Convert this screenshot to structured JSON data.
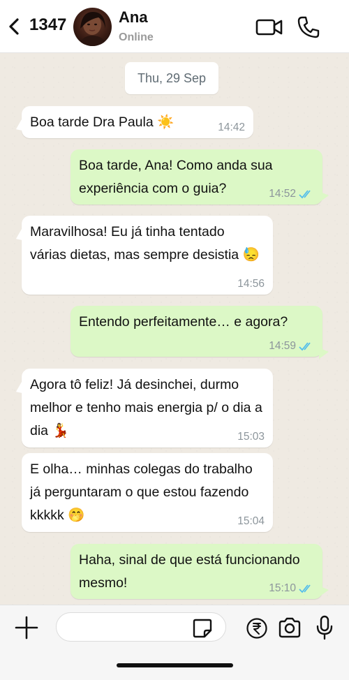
{
  "header": {
    "unread_count": "1347",
    "contact_name": "Ana",
    "contact_status": "Online",
    "icons": [
      "chevron-left-icon",
      "video-camera-icon",
      "phone-icon"
    ]
  },
  "chat": {
    "date_chip": "Thu, 29 Sep",
    "messages": [
      {
        "direction": "in",
        "text": "Boa tarde Dra Paula ☀️",
        "time": "14:42",
        "read": false
      },
      {
        "direction": "out",
        "text": "Boa tarde, Ana! Como anda sua experiência com o guia?",
        "time": "14:52",
        "read": true
      },
      {
        "direction": "in",
        "text": "Maravilhosa! Eu já tinha tentado várias dietas, mas sempre desistia 😓",
        "time": "14:56",
        "read": false
      },
      {
        "direction": "out",
        "text": "Entendo perfeitamente… e agora?",
        "time": "14:59",
        "read": true
      },
      {
        "direction": "in",
        "text": "Agora tô feliz! Já desinchei, durmo melhor e tenho mais energia p/ o dia a dia 💃",
        "time": "15:03",
        "read": false
      },
      {
        "direction": "in",
        "text": "E olha… minhas colegas do trabalho já perguntaram o que estou fazendo kkkkk 🤭",
        "time": "15:04",
        "read": false
      },
      {
        "direction": "out",
        "text": "Haha, sinal de que está funcionando mesmo!",
        "time": "15:10",
        "read": true
      }
    ]
  },
  "composer": {
    "input_value": "",
    "input_placeholder": "",
    "icons": [
      "plus-icon",
      "sticker-icon",
      "rupee-payment-icon",
      "camera-icon",
      "microphone-icon"
    ]
  },
  "colors": {
    "chat_background": "#efeae2",
    "incoming_bubble": "#ffffff",
    "outgoing_bubble": "#dcf8c6",
    "read_ticks": "#53bdeb",
    "timestamp": "#8c959b"
  }
}
